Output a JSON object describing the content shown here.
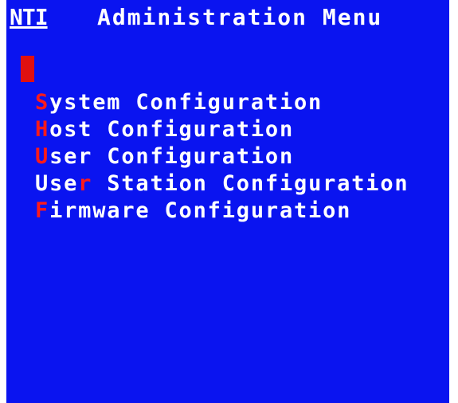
{
  "header": {
    "logo_text": "NTI",
    "title": "Administration Menu"
  },
  "menu": {
    "items": [
      {
        "hotkey": "S",
        "pre": "",
        "post": "ystem Configuration"
      },
      {
        "hotkey": "H",
        "pre": "",
        "post": "ost Configuration"
      },
      {
        "hotkey": "U",
        "pre": "",
        "post": "ser Configuration"
      },
      {
        "hotkey": "r",
        "pre": "Use",
        "post": " Station Configuration"
      },
      {
        "hotkey": "F",
        "pre": "",
        "post": "irmware Configuration"
      }
    ]
  },
  "colors": {
    "background": "#0a14f0",
    "text": "#ffffff",
    "hotkey": "#ff1a1a",
    "cursor": "#e01010"
  }
}
